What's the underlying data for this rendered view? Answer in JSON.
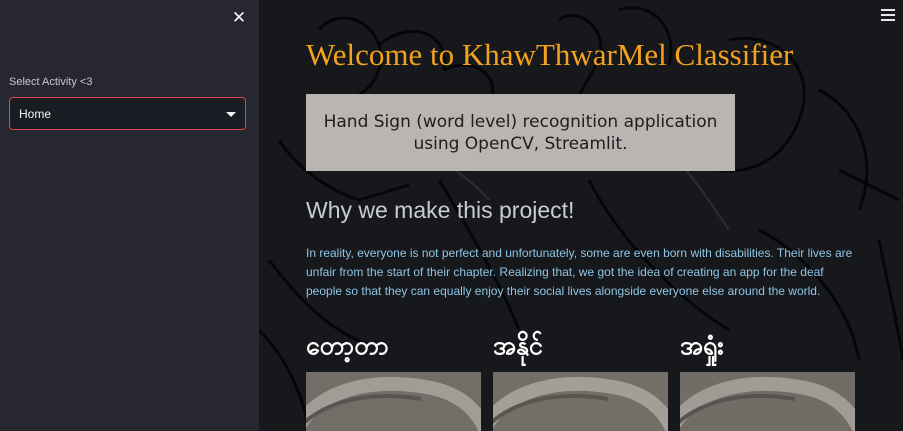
{
  "sidebar": {
    "close_icon": "close-icon",
    "select_label": "Select Activity <3",
    "select_value": "Home",
    "accent_color": "#e0444b"
  },
  "header": {
    "menu_icon": "hamburger-menu-icon"
  },
  "main": {
    "title": "Welcome to KhawThwarMel Classifier",
    "title_color": "#f2a21f",
    "info_lines": [
      "Hand Sign (word level) recognition application",
      "using OpenCV, Streamlit."
    ],
    "heading": "Why we make this project!",
    "paragraph": "In reality, everyone is not perfect and unfortunately, some are even born with disabilities. Their lives are unfair from the start of their chapter. Realizing that, we got the idea of creating an app for the deaf people so that they can equally enjoy their social lives alongside everyone else around the world.",
    "gallery": [
      {
        "label": "တော့တာ"
      },
      {
        "label": "အနိုင်"
      },
      {
        "label": "အရှုံး"
      }
    ]
  }
}
